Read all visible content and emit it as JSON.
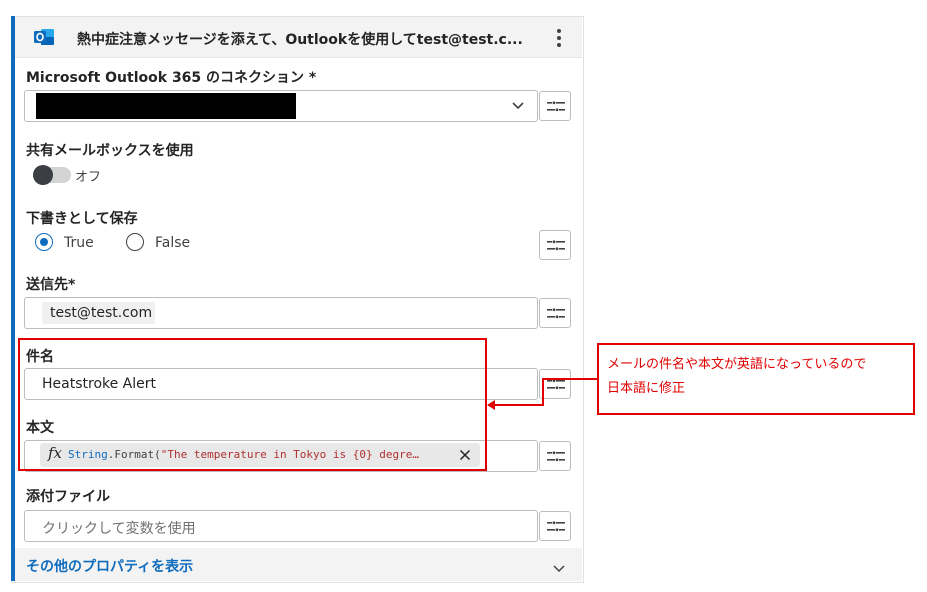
{
  "action": {
    "title": "熱中症注意メッセージを添えて、Outlookを使用してtest@test.c...",
    "icon": "outlook-icon",
    "more_icon": "more-vertical-icon"
  },
  "connection": {
    "label": "Microsoft Outlook 365 のコネクション *",
    "value_redacted": true
  },
  "shared_mailbox": {
    "label": "共有メールボックスを使用",
    "toggle_state": "オフ"
  },
  "save_as_draft": {
    "label": "下書きとして保存",
    "options": [
      "True",
      "False"
    ],
    "selected": "True"
  },
  "recipient": {
    "label": "送信先*",
    "value": "test@test.com"
  },
  "subject": {
    "label": "件名",
    "value": "Heatstroke Alert"
  },
  "body": {
    "label": "本文",
    "expr_keyword": "String",
    "expr_method": ".Format(",
    "expr_string": "\"The temperature in Tokyo is {0} degre…"
  },
  "attachment": {
    "label": "添付ファイル",
    "placeholder": "クリックして変数を使用"
  },
  "more_properties": {
    "label": "その他のプロパティを表示"
  },
  "annotation": {
    "line1": "メールの件名や本文が英語になっているので",
    "line2": "日本語に修正"
  },
  "colors": {
    "accent": "#0f6cbd",
    "annotation_red": "#e00000"
  }
}
